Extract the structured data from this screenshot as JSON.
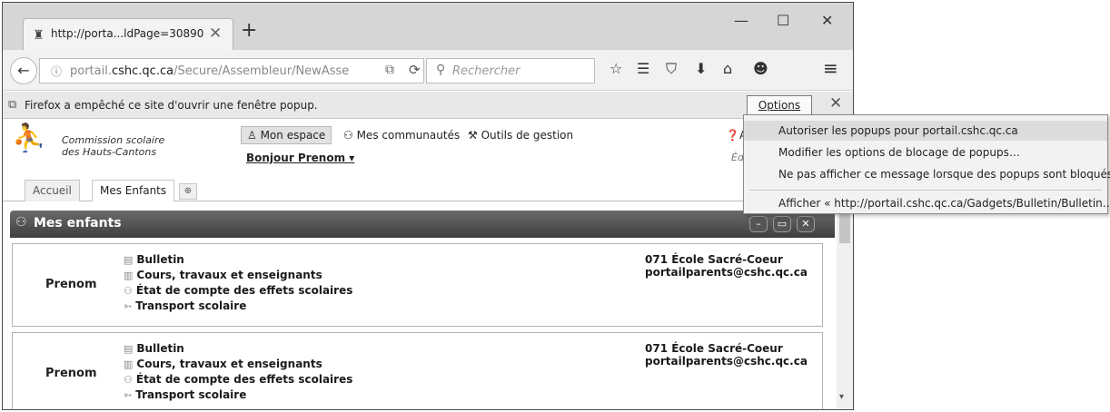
{
  "browser": {
    "tab": {
      "title": "http://porta...ldPage=30890",
      "close": "✕"
    },
    "new_tab": "+",
    "window_controls": {
      "minimize": "—",
      "maximize": "☐",
      "close": "✕"
    },
    "nav": {
      "back": "←",
      "info_icon": "ⓘ",
      "url_prefix": "portail.",
      "url_domain": "cshc.qc.ca",
      "url_path": "/Secure/Assembleur/NewAsse",
      "popup_icon": "⧉",
      "reload": "⟳",
      "search_icon": "⚲",
      "search_placeholder": "Rechercher"
    },
    "toolbar_icons": {
      "bookmark_star": "☆",
      "reading_list": "☰",
      "pocket": "⛉",
      "download": "⬇",
      "home": "⌂",
      "chat": "☻",
      "menu": "≡"
    },
    "popup_bar": {
      "message": "Firefox a empêché ce site d'ouvrir une fenêtre popup.",
      "options": "Options",
      "close": "✕"
    }
  },
  "dropdown": {
    "items": [
      "Autoriser les popups pour portail.cshc.qc.ca",
      "Modifier les options de blocage de popups…",
      "Ne pas afficher ce message lorsque des popups sont bloqués",
      "Afficher « http://portail.cshc.qc.ca/Gadgets/Bulletin/Bulletin…"
    ]
  },
  "site": {
    "logo": {
      "line1": "Commission scolaire",
      "line2": "des Hauts-Cantons"
    },
    "nav": {
      "mon_espace": "Mon espace",
      "communautes": "Mes communautés",
      "outils": "Outils de gestion",
      "aide": "Aid"
    },
    "greeting": "Bonjour Prenom ▾",
    "ed": "Éd",
    "tabs": {
      "accueil": "Accueil",
      "enfants": "Mes Enfants",
      "add": "⊕"
    },
    "panel": {
      "title": "Mes enfants",
      "minimize": "–",
      "maximize": "▭",
      "close": "✕"
    },
    "children": [
      {
        "name": "Prenom",
        "links": [
          "Bulletin",
          "Cours, travaux et enseignants",
          "État de compte des effets scolaires",
          "Transport scolaire"
        ],
        "school": "071 École Sacré-Coeur",
        "email": "portailparents@cshc.qc.ca"
      },
      {
        "name": "Prenom",
        "links": [
          "Bulletin",
          "Cours, travaux et enseignants",
          "État de compte des effets scolaires",
          "Transport scolaire"
        ],
        "school": "071 École Sacré-Coeur",
        "email": "portailparents@cshc.qc.ca"
      }
    ],
    "scroll_down": "▾"
  },
  "colors": {
    "titlebar": "#d6d6d6",
    "panel_header": "#4a4a4a",
    "dropdown_selected": "#dcdcdc"
  }
}
